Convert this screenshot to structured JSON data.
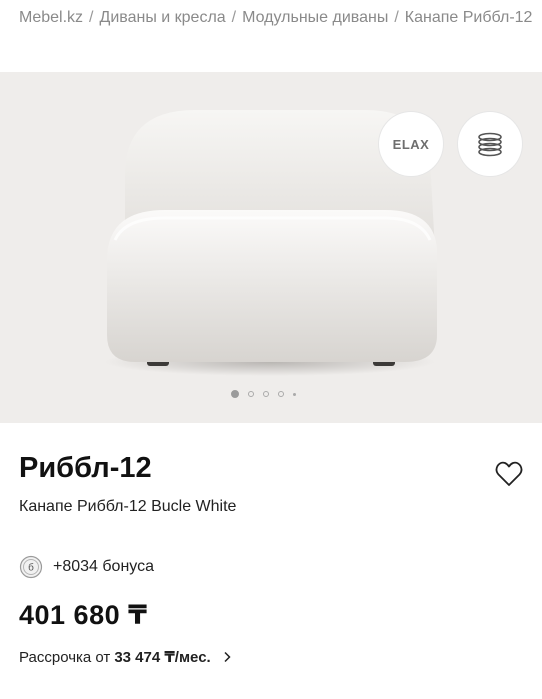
{
  "breadcrumb": {
    "items": [
      "Mebel.kz",
      "Диваны и кресла",
      "Модульные диваны",
      "Канапе Риббл-12"
    ],
    "separator": "/"
  },
  "gallery": {
    "brand_button": "ELAX",
    "layers_icon": "layers-icon",
    "slides_total": 5,
    "active_slide": 1
  },
  "product": {
    "title": "Риббл-12",
    "subtitle": "Канапе Риббл-12 Bucle White",
    "bonus_badge": "б",
    "bonus_text": "+8034 бонуса",
    "price": "401 680 ₸",
    "installment_prefix": "Рассрочка от",
    "installment_amount": "33 474 ₸/мес."
  },
  "colors": {
    "background_gallery": "#efedeb",
    "text_primary": "#111111",
    "text_muted": "#8a8a8a"
  }
}
